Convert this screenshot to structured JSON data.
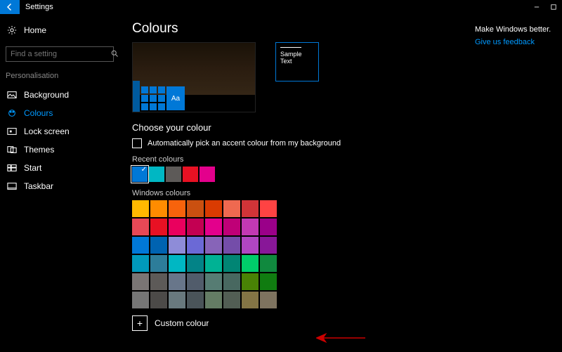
{
  "titlebar": {
    "title": "Settings"
  },
  "sidebar": {
    "home": "Home",
    "search_placeholder": "Find a setting",
    "group": "Personalisation",
    "items": [
      {
        "label": "Background"
      },
      {
        "label": "Colours"
      },
      {
        "label": "Lock screen"
      },
      {
        "label": "Themes"
      },
      {
        "label": "Start"
      },
      {
        "label": "Taskbar"
      }
    ]
  },
  "page": {
    "heading": "Colours",
    "sample_text": "Sample Text",
    "tile_char": "Aa",
    "choose_heading": "Choose your colour",
    "auto_checkbox": "Automatically pick an accent colour from my background",
    "recent_label": "Recent colours",
    "recent": [
      "#0078d7",
      "#00b7c3",
      "#5d5a58",
      "#e81123",
      "#e3008c"
    ],
    "windows_label": "Windows colours",
    "grid": [
      "#ffb900",
      "#ff8c00",
      "#f7630c",
      "#ca5010",
      "#da3b01",
      "#ef6950",
      "#d13438",
      "#ff4343",
      "#e74856",
      "#e81123",
      "#ea005e",
      "#c30052",
      "#e3008c",
      "#bf0077",
      "#c239b3",
      "#9a0089",
      "#0078d7",
      "#0063b1",
      "#8e8cd8",
      "#6b69d6",
      "#8764b8",
      "#744da9",
      "#b146c2",
      "#881798",
      "#0099bc",
      "#2d7d9a",
      "#00b7c3",
      "#038387",
      "#00b294",
      "#018574",
      "#00cc6a",
      "#10893e",
      "#7a7574",
      "#5d5a58",
      "#68768a",
      "#515c6b",
      "#567c73",
      "#486860",
      "#498205",
      "#107c10",
      "#767676",
      "#4c4a48",
      "#69797e",
      "#4a5459",
      "#647c64",
      "#525e54",
      "#847545",
      "#7e735f"
    ],
    "custom_label": "Custom colour",
    "plus": "+"
  },
  "right": {
    "title": "Make Windows better.",
    "link": "Give us feedback"
  }
}
